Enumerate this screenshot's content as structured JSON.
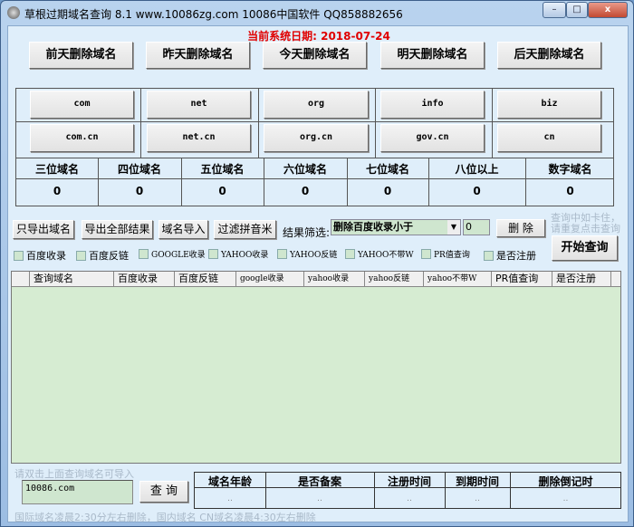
{
  "window": {
    "title": "草根过期域名查询 8.1    www.10086zg.com  10086中国软件 QQ858882656",
    "minimize": "–",
    "maximize": "□",
    "close": "x"
  },
  "date_label": "当前系统日期: 2018-07-24",
  "day_buttons": [
    "前天删除域名",
    "昨天删除域名",
    "今天删除域名",
    "明天删除域名",
    "后天删除域名"
  ],
  "tld_buttons": [
    [
      "com",
      "net",
      "org",
      "info",
      "biz"
    ],
    [
      "com.cn",
      "net.cn",
      "org.cn",
      "gov.cn",
      "cn"
    ]
  ],
  "stats": {
    "headers": [
      "三位域名",
      "四位域名",
      "五位域名",
      "六位域名",
      "七位域名",
      "八位以上",
      "数字域名"
    ],
    "values": [
      "0",
      "0",
      "0",
      "0",
      "0",
      "0",
      "0"
    ]
  },
  "toolbar": {
    "export_domains": "只导出域名",
    "export_all": "导出全部结果",
    "import": "域名导入",
    "filter_pinyin": "过滤拼音米",
    "filter_label": "结果筛选:",
    "filter_select": "删除百度收录小于",
    "filter_value": "0",
    "delete": "删 除",
    "hint": "查询中如卡住，请重复点击查询",
    "start": "开始查询"
  },
  "checkboxes": [
    "百度收录",
    "百度反链",
    "GOOGLE收录",
    "YAHOO收录",
    "YAHOO反链",
    "YAHOO不带W",
    "PR值查询",
    "是否注册"
  ],
  "grid_columns": [
    "查询域名",
    "百度收录",
    "百度反链",
    "google收录",
    "yahoo收录",
    "yahoo反链",
    "yahoo不带W",
    "PR值查询",
    "是否注册"
  ],
  "lookup": {
    "label": "请双击上面查询域名可导入",
    "input": "10086.com",
    "button": "查 询"
  },
  "info_table": {
    "headers": [
      "域名年龄",
      "是否备案",
      "注册时间",
      "到期时间",
      "删除倒记时"
    ],
    "values": [
      "..",
      "..",
      "..",
      "..",
      ".."
    ]
  },
  "footer": "国际域名凌晨2:30分左右删除，国内域名 CN域名凌晨4:30左右删除"
}
